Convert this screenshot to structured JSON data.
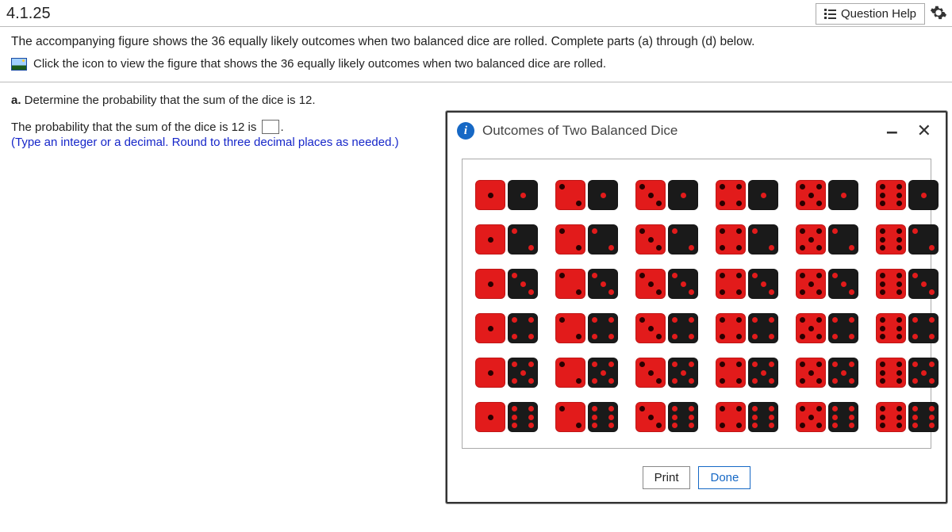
{
  "question_number": "4.1.25",
  "question_help_label": "Question Help",
  "intro_text": "The accompanying figure shows the 36 equally likely outcomes when two balanced dice are rolled. Complete parts (a) through (d) below.",
  "figure_link_text": "Click the icon to view the figure that shows the 36 equally likely outcomes when two balanced dice are rolled.",
  "part_a": {
    "label": "a.",
    "prompt": " Determine the probability that the sum of the dice is 12.",
    "answer_prefix": "The probability that the sum of the dice is 12 is ",
    "answer_suffix": ".",
    "hint": "(Type an integer or a decimal. Round to three decimal places as needed.)"
  },
  "modal": {
    "title": "Outcomes of Two Balanced Dice",
    "print_label": "Print",
    "done_label": "Done"
  },
  "dice_grid": {
    "rows": 6,
    "cols": 6
  },
  "chart_data": {
    "type": "table",
    "title": "Outcomes of Two Balanced Dice",
    "description": "6×6 grid of ordered pairs (red_die, black_die). Columns vary red die 1–6, rows vary black die 1–6.",
    "rows": [
      [
        [
          1,
          1
        ],
        [
          2,
          1
        ],
        [
          3,
          1
        ],
        [
          4,
          1
        ],
        [
          5,
          1
        ],
        [
          6,
          1
        ]
      ],
      [
        [
          1,
          2
        ],
        [
          2,
          2
        ],
        [
          3,
          2
        ],
        [
          4,
          2
        ],
        [
          5,
          2
        ],
        [
          6,
          2
        ]
      ],
      [
        [
          1,
          3
        ],
        [
          2,
          3
        ],
        [
          3,
          3
        ],
        [
          4,
          3
        ],
        [
          5,
          3
        ],
        [
          6,
          3
        ]
      ],
      [
        [
          1,
          4
        ],
        [
          2,
          4
        ],
        [
          3,
          4
        ],
        [
          4,
          4
        ],
        [
          5,
          4
        ],
        [
          6,
          4
        ]
      ],
      [
        [
          1,
          5
        ],
        [
          2,
          5
        ],
        [
          3,
          5
        ],
        [
          4,
          5
        ],
        [
          5,
          5
        ],
        [
          6,
          5
        ]
      ],
      [
        [
          1,
          6
        ],
        [
          2,
          6
        ],
        [
          3,
          6
        ],
        [
          4,
          6
        ],
        [
          5,
          6
        ],
        [
          6,
          6
        ]
      ]
    ]
  }
}
